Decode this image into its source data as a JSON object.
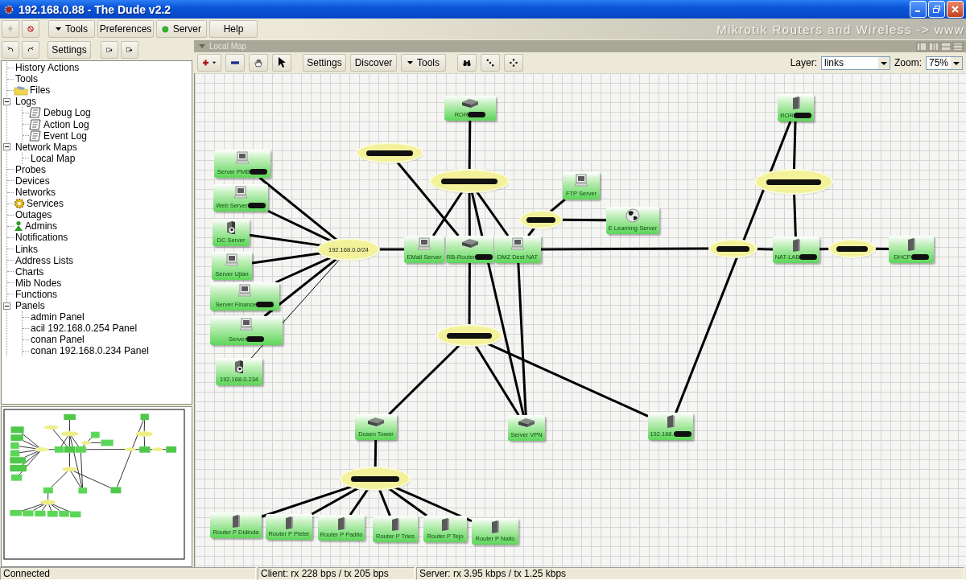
{
  "window": {
    "title": "192.168.0.88 - The Dude v2.2"
  },
  "toolbar": {
    "buttons": [
      {
        "label": "Tools",
        "kind": "menu"
      },
      {
        "label": "Preferences",
        "kind": "plain"
      },
      {
        "label": "Server",
        "kind": "status",
        "online": true
      },
      {
        "label": "Help",
        "kind": "plain"
      }
    ],
    "banner": "Mikrotik Routers and Wireless -> www"
  },
  "secondary_toolbar": {
    "settings_label": "Settings"
  },
  "tree": [
    {
      "label": "History Actions",
      "kind": "plain"
    },
    {
      "label": "Tools",
      "kind": "plain"
    },
    {
      "label": "Files",
      "kind": "folder"
    },
    {
      "label": "Logs",
      "kind": "plain",
      "expanded": true,
      "children": [
        {
          "label": "Debug Log",
          "kind": "log"
        },
        {
          "label": "Action Log",
          "kind": "log"
        },
        {
          "label": "Event Log",
          "kind": "log"
        }
      ]
    },
    {
      "label": "Network Maps",
      "kind": "plain",
      "expanded": true,
      "children": [
        {
          "label": "Local Map",
          "kind": "plain"
        }
      ]
    },
    {
      "label": "Probes",
      "kind": "plain"
    },
    {
      "label": "Devices",
      "kind": "plain"
    },
    {
      "label": "Networks",
      "kind": "plain"
    },
    {
      "label": "Services",
      "kind": "service"
    },
    {
      "label": "Outages",
      "kind": "plain"
    },
    {
      "label": "Admins",
      "kind": "admin"
    },
    {
      "label": "Notifications",
      "kind": "plain"
    },
    {
      "label": "Links",
      "kind": "plain"
    },
    {
      "label": "Address Lists",
      "kind": "plain"
    },
    {
      "label": "Charts",
      "kind": "plain"
    },
    {
      "label": "Mib Nodes",
      "kind": "plain"
    },
    {
      "label": "Functions",
      "kind": "plain"
    },
    {
      "label": "Panels",
      "kind": "plain",
      "expanded": true,
      "children": [
        {
          "label": "admin Panel",
          "kind": "plain"
        },
        {
          "label": "acil 192.168.0.254 Panel",
          "kind": "plain"
        },
        {
          "label": "conan Panel",
          "kind": "plain"
        },
        {
          "label": "conan 192.168.0.234 Panel",
          "kind": "plain"
        }
      ]
    }
  ],
  "map": {
    "title": "Local Map",
    "toolbar": {
      "buttons": [
        {
          "label": "Settings",
          "kind": "plain"
        },
        {
          "label": "Discover",
          "kind": "plain"
        },
        {
          "label": "Tools",
          "kind": "menu"
        }
      ],
      "layer_label": "Layer:",
      "layer": "links",
      "zoom_label": "Zoom:",
      "zoom": "75%"
    },
    "devices": [
      {
        "label": "ROR",
        "kind": "router",
        "redacted": true
      },
      {
        "label": "Server PMB",
        "kind": "pc",
        "redacted": true
      },
      {
        "label": "Web Server",
        "kind": "pc",
        "redacted": true
      },
      {
        "label": "DC Server",
        "kind": "server",
        "redacted": false
      },
      {
        "label": "Server Ujian",
        "kind": "pc",
        "redacted": false
      },
      {
        "label": "Server Finance",
        "kind": "pc",
        "redacted": true
      },
      {
        "label": "Server",
        "kind": "pc",
        "redacted": true
      },
      {
        "label": "192.168.0.234",
        "kind": "server",
        "redacted": false
      },
      {
        "label": "EMail Server",
        "kind": "pc",
        "redacted": false
      },
      {
        "label": "RB-Router",
        "kind": "router",
        "redacted": true
      },
      {
        "label": "DMZ Dest NAT",
        "kind": "pc",
        "redacted": false
      },
      {
        "label": "FTP Server",
        "kind": "pc",
        "redacted": false
      },
      {
        "label": "E Learning Server",
        "kind": "globe",
        "redacted": false
      },
      {
        "label": "ROR",
        "kind": "tower",
        "redacted": true
      },
      {
        "label": "NAT-LAB",
        "kind": "tower",
        "redacted": true
      },
      {
        "label": "DHCP",
        "kind": "tower",
        "redacted": true
      },
      {
        "label": "Dosen Tower",
        "kind": "router",
        "redacted": false
      },
      {
        "label": "Server VPN",
        "kind": "router",
        "redacted": false
      },
      {
        "label": "192.168.",
        "kind": "tower",
        "redacted": true
      },
      {
        "label": "Router P Didinda",
        "kind": "tower",
        "redacted": false
      },
      {
        "label": "Router P Pieter",
        "kind": "tower",
        "redacted": false
      },
      {
        "label": "Router P Padito",
        "kind": "tower",
        "redacted": false
      },
      {
        "label": "Router P Tries",
        "kind": "tower",
        "redacted": false
      },
      {
        "label": "Router P Tejo",
        "kind": "tower",
        "redacted": false
      },
      {
        "label": "Router P Naito",
        "kind": "tower",
        "redacted": false
      }
    ],
    "networks": [
      {
        "redacted": true
      },
      {
        "redacted": true
      },
      {
        "label": "192.168.0.0/24",
        "redacted": false
      },
      {
        "redacted": true
      },
      {
        "redacted": true
      },
      {
        "redacted": true
      },
      {
        "redacted": true
      },
      {
        "redacted": true
      },
      {
        "redacted": true
      }
    ]
  },
  "status_bar": {
    "connection": "Connected",
    "client": "Client: rx 228 bps / tx 205 bps",
    "server": "Server: rx 3.95 kbps / tx 1.25 kbps"
  }
}
